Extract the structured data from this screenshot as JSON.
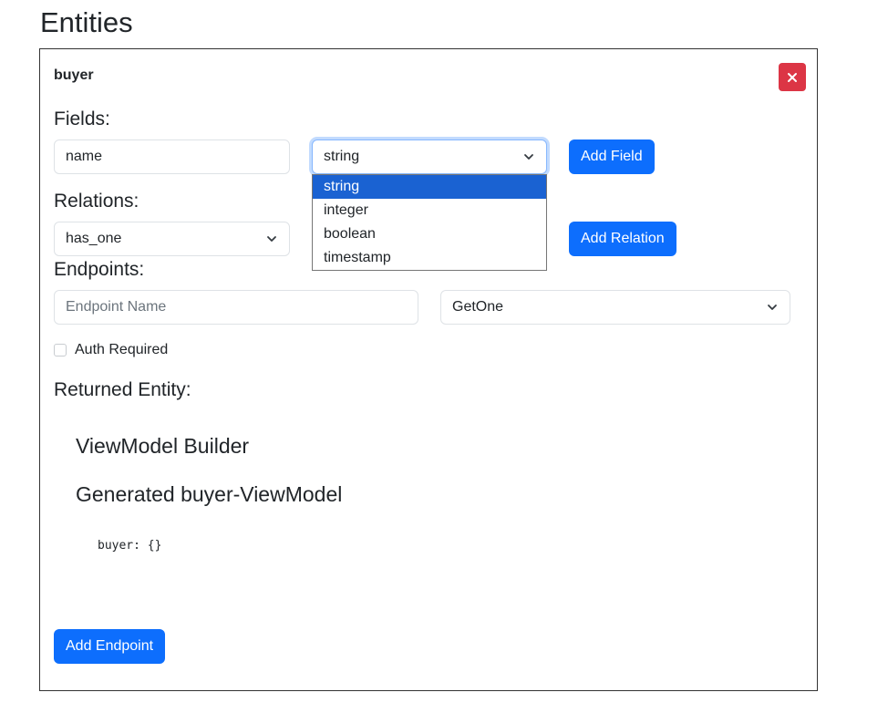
{
  "page": {
    "title": "Entities"
  },
  "entity": {
    "name": "buyer",
    "close_label": "×",
    "fields": {
      "label": "Fields:",
      "name_value": "name",
      "type_selected": "string",
      "type_options": [
        "string",
        "integer",
        "boolean",
        "timestamp"
      ],
      "add_label": "Add Field"
    },
    "relations": {
      "label": "Relations:",
      "type_selected": "has_one",
      "add_label": "Add Relation"
    },
    "endpoints": {
      "label": "Endpoints:",
      "name_placeholder": "Endpoint Name",
      "method_selected": "GetOne",
      "auth_label": "Auth Required",
      "auth_checked": false,
      "returned_label": "Returned Entity:",
      "viewmodel_builder_title": "ViewModel Builder",
      "generated_title": "Generated buyer-ViewModel",
      "generated_code": "buyer: {}",
      "add_label": "Add Endpoint"
    }
  },
  "colors": {
    "primary": "#0d6efd",
    "danger": "#dc3545",
    "option_highlight": "#1a62d2"
  },
  "icons": {
    "close": "close-icon",
    "chevron": "chevron-down-icon"
  }
}
